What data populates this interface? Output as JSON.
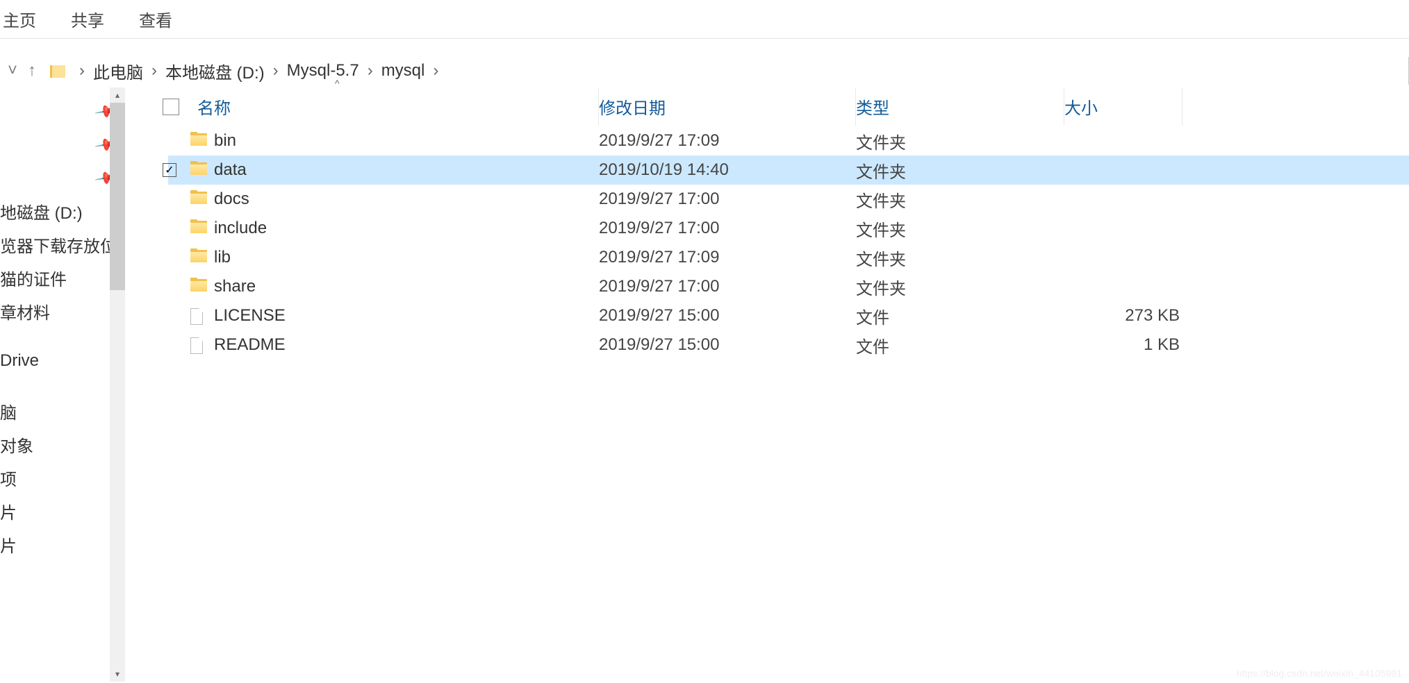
{
  "ribbon": {
    "tabs": [
      "主页",
      "共享",
      "查看"
    ]
  },
  "breadcrumb": {
    "segments": [
      "此电脑",
      "本地磁盘 (D:)",
      "Mysql-5.7",
      "mysql"
    ]
  },
  "sidebar": {
    "items": [
      "",
      "",
      "",
      "地磁盘 (D:)",
      "览器下载存放位",
      "猫的证件",
      "章材料",
      "Drive",
      "脑",
      "对象",
      "项",
      "片",
      "片"
    ]
  },
  "columns": {
    "name": "名称",
    "date": "修改日期",
    "type": "类型",
    "size": "大小"
  },
  "rows": [
    {
      "name": "bin",
      "date": "2019/9/27 17:09",
      "type": "文件夹",
      "size": "",
      "kind": "folder",
      "selected": false
    },
    {
      "name": "data",
      "date": "2019/10/19 14:40",
      "type": "文件夹",
      "size": "",
      "kind": "folder",
      "selected": true
    },
    {
      "name": "docs",
      "date": "2019/9/27 17:00",
      "type": "文件夹",
      "size": "",
      "kind": "folder",
      "selected": false
    },
    {
      "name": "include",
      "date": "2019/9/27 17:00",
      "type": "文件夹",
      "size": "",
      "kind": "folder",
      "selected": false
    },
    {
      "name": "lib",
      "date": "2019/9/27 17:09",
      "type": "文件夹",
      "size": "",
      "kind": "folder",
      "selected": false
    },
    {
      "name": "share",
      "date": "2019/9/27 17:00",
      "type": "文件夹",
      "size": "",
      "kind": "folder",
      "selected": false
    },
    {
      "name": "LICENSE",
      "date": "2019/9/27 15:00",
      "type": "文件",
      "size": "273 KB",
      "kind": "file",
      "selected": false
    },
    {
      "name": "README",
      "date": "2019/9/27 15:00",
      "type": "文件",
      "size": "1 KB",
      "kind": "file",
      "selected": false
    }
  ],
  "icons": {
    "sep": "›",
    "up": "↑",
    "back": "˅",
    "check": "✓",
    "sort": "^",
    "pin": "📌"
  },
  "watermark": "https://blog.csdn.net/weixin_44105991"
}
